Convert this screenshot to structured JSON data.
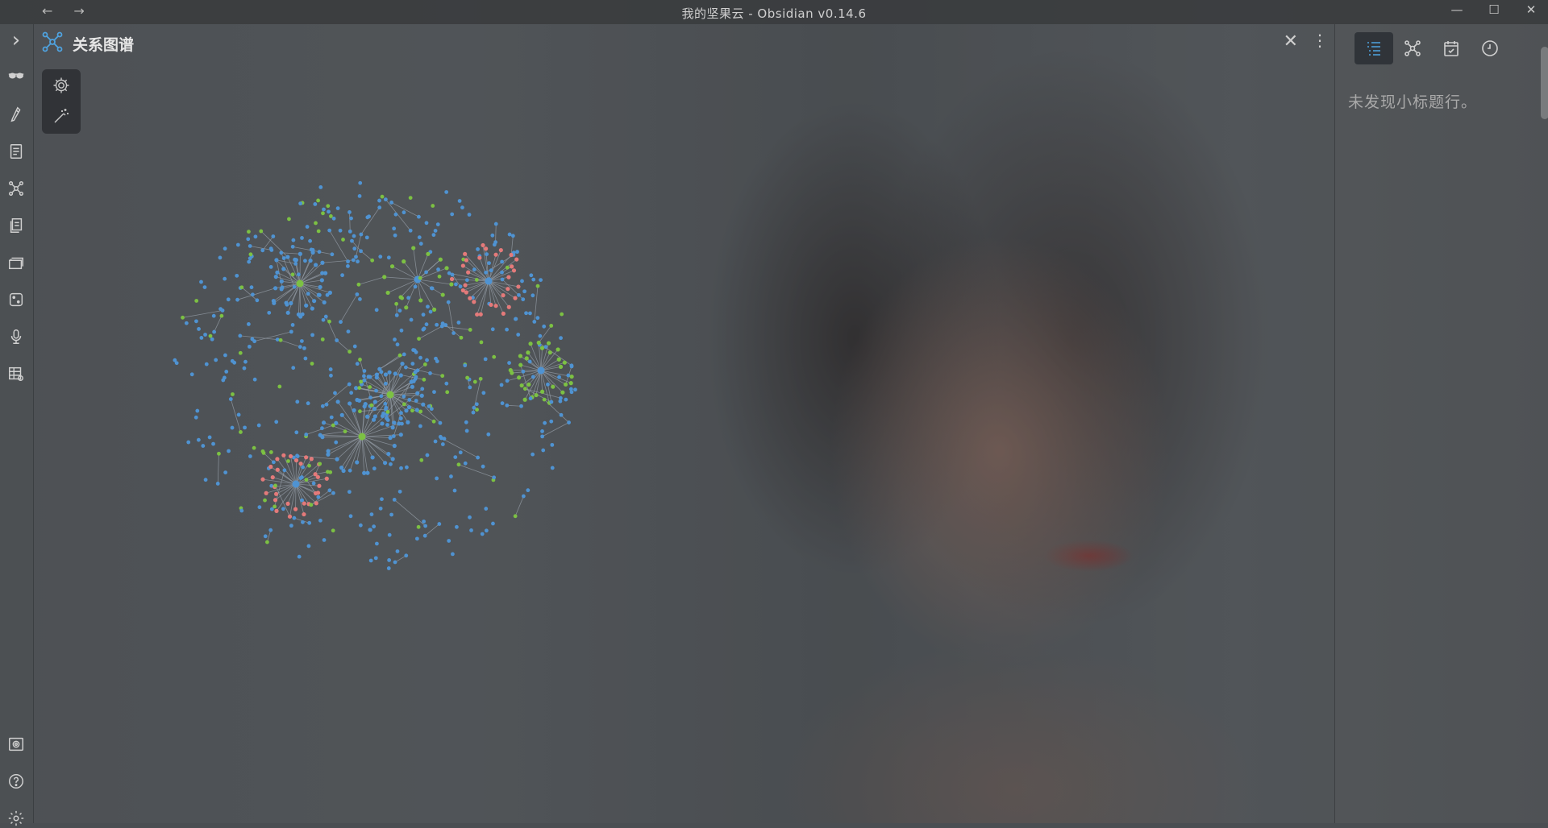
{
  "window": {
    "title": "我的坚果云 - Obsidian v0.14.6",
    "back_glyph": "←",
    "forward_glyph": "→",
    "minimize_glyph": "—",
    "maximize_glyph": "☐",
    "close_glyph": "✕"
  },
  "ribbon": {
    "expand_glyph": "›",
    "icons": [
      "glasses-icon",
      "pen-icon",
      "document-icon",
      "graph-icon",
      "files-icon",
      "cards-icon",
      "dice-icon",
      "microphone-icon",
      "table-settings-icon",
      "vault-icon",
      "help-icon",
      "settings-icon"
    ]
  },
  "graph_view": {
    "title": "关系图谱",
    "close_glyph": "✕",
    "more_glyph": "⋮",
    "colors": {
      "default_node": "#4f93d2",
      "tag_node": "#7cc143",
      "highlight_node": "#e47a7a",
      "edge": "#9aa3ad",
      "accent": "#4fa3e0"
    }
  },
  "sidebar": {
    "tabs": [
      "outline-icon",
      "local-graph-icon",
      "calendar-icon",
      "recent-icon"
    ],
    "active_tab": "outline-icon",
    "empty_message": "未发现小标题行。"
  }
}
